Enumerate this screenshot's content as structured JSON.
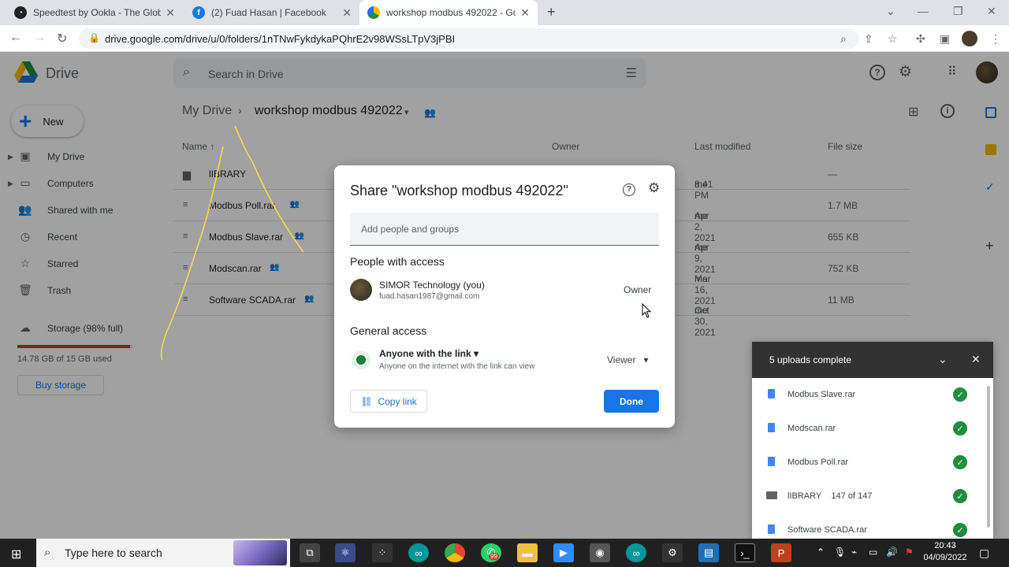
{
  "browser": {
    "tabs": [
      {
        "title": "Speedtest by Ookla - The Global"
      },
      {
        "title": "(2) Fuad Hasan | Facebook"
      },
      {
        "title": "workshop modbus 492022 - Goo"
      }
    ],
    "url": "drive.google.com/drive/u/0/folders/1nTNwFykdykaPQhrE2v98WSsLTpV3jPBI"
  },
  "drive": {
    "app_name": "Drive",
    "search_placeholder": "Search in Drive",
    "new_label": "New",
    "nav": [
      "My Drive",
      "Computers",
      "Shared with me",
      "Recent",
      "Starred",
      "Trash"
    ],
    "storage_label": "Storage (98% full)",
    "storage_used": "14.78 GB of 15 GB used",
    "storage_fraction": 0.98,
    "buy_storage": "Buy storage",
    "breadcrumb_root": "My Drive",
    "breadcrumb_folder": "workshop modbus 492022",
    "columns": {
      "name": "Name",
      "owner": "Owner",
      "last_modified": "Last modified",
      "file_size": "File size"
    },
    "files": [
      {
        "name": "lIBRARY",
        "modified": "8:41 PM",
        "modifier": "me",
        "size": "—"
      },
      {
        "name": "Modbus Poll.rar",
        "modified": "Apr 2, 2021",
        "modifier": "me",
        "size": "1.7 MB"
      },
      {
        "name": "Modbus Slave.rar",
        "modified": "Apr 9, 2021",
        "modifier": "me",
        "size": "655 KB"
      },
      {
        "name": "Modscan.rar",
        "modified": "Mar 16, 2021",
        "modifier": "me",
        "size": "752 KB"
      },
      {
        "name": "Software SCADA.rar",
        "modified": "Oct 30, 2021",
        "modifier": "me",
        "size": "11 MB"
      }
    ]
  },
  "share_dialog": {
    "title": "Share \"workshop modbus 492022\"",
    "add_placeholder": "Add people and groups",
    "people_heading": "People with access",
    "person_name": "SIMOR Technology (you)",
    "person_email": "fuad.hasan1987@gmail.com",
    "person_role": "Owner",
    "general_heading": "General access",
    "access_name": "Anyone with the link",
    "access_desc": "Anyone on the internet with the link can view",
    "access_role": "Viewer",
    "copy_link": "Copy link",
    "done": "Done"
  },
  "uploads": {
    "title": "5 uploads complete",
    "items": [
      {
        "name": "Modbus Slave.rar"
      },
      {
        "name": "Modscan.rar"
      },
      {
        "name": "Modbus Poll.rar"
      },
      {
        "name": "lIBRARY",
        "detail": "147 of 147"
      },
      {
        "name": "Software SCADA.rar"
      }
    ]
  },
  "taskbar": {
    "search_placeholder": "Type here to search",
    "whatsapp_badge": "99",
    "time": "20:43",
    "date": "04/09/2022"
  },
  "colors": {
    "accent": "#1a73e8",
    "success": "#1e8e3e",
    "annotation": "#f9d949"
  }
}
